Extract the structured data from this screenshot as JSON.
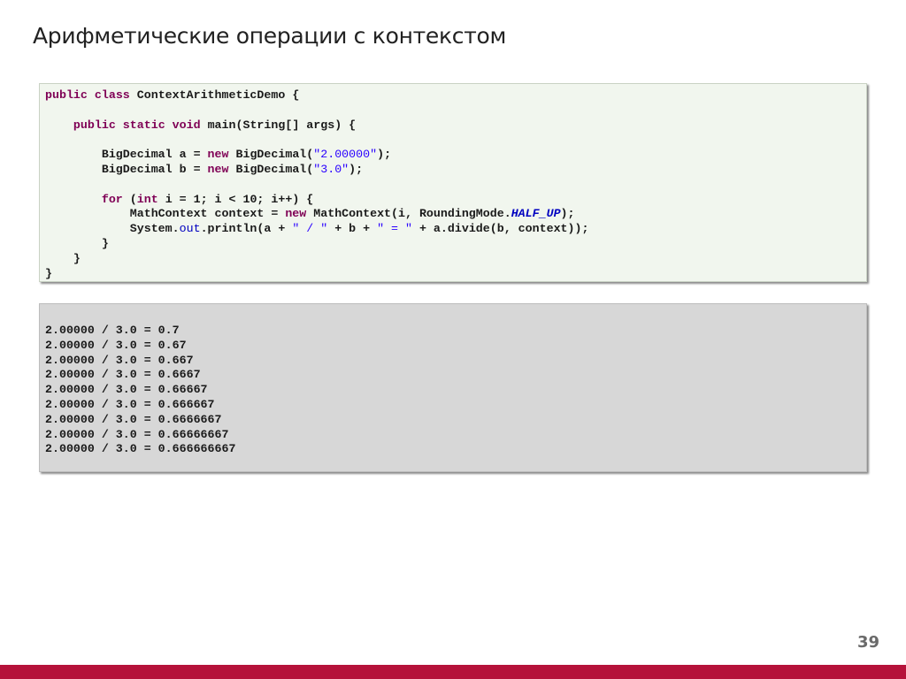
{
  "slide": {
    "title": "Арифметические операции с контекстом",
    "page_number": "39"
  },
  "code": {
    "line1": {
      "kw1": "public",
      "kw2": "class",
      "name": "ContextArithmeticDemo {"
    },
    "line2": {
      "kw1": "public",
      "kw2": "static",
      "kw3": "void",
      "rest": "main(String[] args) {"
    },
    "line3": {
      "pre": "BigDecimal a = ",
      "kw": "new",
      "mid": " BigDecimal(",
      "str": "\"2.00000\"",
      "post": ");"
    },
    "line4": {
      "pre": "BigDecimal b = ",
      "kw": "new",
      "mid": " BigDecimal(",
      "str": "\"3.0\"",
      "post": ");"
    },
    "line5": {
      "kw1": "for",
      "a": " (",
      "kw2": "int",
      "rest": " i = 1; i < 10; i++) {"
    },
    "line6": {
      "pre": "MathContext context = ",
      "kw": "new",
      "mid": " MathContext(i, RoundingMode.",
      "field": "HALF_UP",
      "post": ");"
    },
    "line7": {
      "pre": "System.",
      "field": "out",
      "a": ".println(a + ",
      "s1": "\" / \"",
      "b": " + b + ",
      "s2": "\" = \"",
      "c": " + a.divide(b, context));"
    },
    "close3": "}",
    "close2": "}",
    "close1": "}"
  },
  "output": {
    "lines": [
      "2.00000 / 3.0 = 0.7",
      "2.00000 / 3.0 = 0.67",
      "2.00000 / 3.0 = 0.667",
      "2.00000 / 3.0 = 0.6667",
      "2.00000 / 3.0 = 0.66667",
      "2.00000 / 3.0 = 0.666667",
      "2.00000 / 3.0 = 0.6666667",
      "2.00000 / 3.0 = 0.66666667",
      "2.00000 / 3.0 = 0.666666667"
    ]
  },
  "colors": {
    "accent_bar": "#b5123a",
    "keyword": "#7f0055",
    "string": "#2a00ff",
    "field": "#0000c0"
  }
}
